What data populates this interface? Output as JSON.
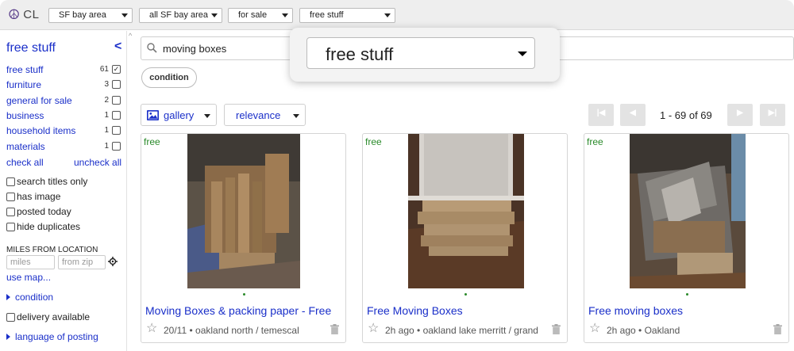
{
  "header": {
    "logo_text": "CL",
    "logo_icon": "peace-icon",
    "selects": [
      "SF bay area",
      "all SF bay area",
      "for sale",
      "free stuff"
    ]
  },
  "sidebar": {
    "title": "free stuff",
    "collapse_glyph": "<",
    "categories": [
      {
        "label": "free stuff",
        "count": "61",
        "checked": true
      },
      {
        "label": "furniture",
        "count": "3",
        "checked": false
      },
      {
        "label": "general for sale",
        "count": "2",
        "checked": false
      },
      {
        "label": "business",
        "count": "1",
        "checked": false
      },
      {
        "label": "household items",
        "count": "1",
        "checked": false
      },
      {
        "label": "materials",
        "count": "1",
        "checked": false
      }
    ],
    "check_all": "check all",
    "uncheck_all": "uncheck all",
    "options": [
      "search titles only",
      "has image",
      "posted today",
      "hide duplicates"
    ],
    "miles_label": "MILES FROM LOCATION",
    "miles_placeholder": "miles",
    "zip_placeholder": "from zip",
    "use_map": "use map...",
    "condition": "condition",
    "delivery": "delivery available",
    "language": "language of posting"
  },
  "search": {
    "query": "moving boxes"
  },
  "filter_pill": "condition",
  "overlay": {
    "selected": "free stuff"
  },
  "view": {
    "gallery": "gallery",
    "sort": "relevance"
  },
  "pagination": {
    "range": "1 - 69 of 69"
  },
  "colors": {
    "link": "#1a2fc9",
    "free": "#2a8a2a",
    "header_bg": "#eeeeee"
  },
  "listings": [
    {
      "price": "free",
      "title": "Moving Boxes & packing paper - Free",
      "date": "20/11",
      "location": "oakland north / temescal"
    },
    {
      "price": "free",
      "title": "Free Moving Boxes",
      "date": "2h ago",
      "location": "oakland lake merritt / grand"
    },
    {
      "price": "free",
      "title": "Free moving boxes",
      "date": "2h ago",
      "location": "Oakland"
    }
  ]
}
